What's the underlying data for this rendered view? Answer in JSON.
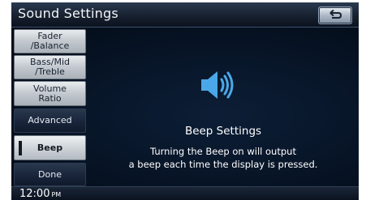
{
  "header": {
    "title": "Sound Settings",
    "back_icon": "back-arrow-icon"
  },
  "sidebar": {
    "items": [
      {
        "label": "Fader\n/Balance",
        "selected": false
      },
      {
        "label": "Bass/Mid\n/Treble",
        "selected": false
      },
      {
        "label": "Volume\nRatio",
        "selected": false
      },
      {
        "label": "Advanced",
        "selected": false
      },
      {
        "label": "Beep",
        "selected": true
      },
      {
        "label": "Done",
        "selected": false
      }
    ]
  },
  "content": {
    "icon": "speaker-volume-icon",
    "title": "Beep Settings",
    "description_line1": "Turning the Beep on will output",
    "description_line2": "a beep each time the display is pressed."
  },
  "status": {
    "time": "12:00",
    "ampm": "PM"
  },
  "colors": {
    "accent": "#4aa8e8",
    "background": "#02070e",
    "selected_marker": "#141a22"
  }
}
